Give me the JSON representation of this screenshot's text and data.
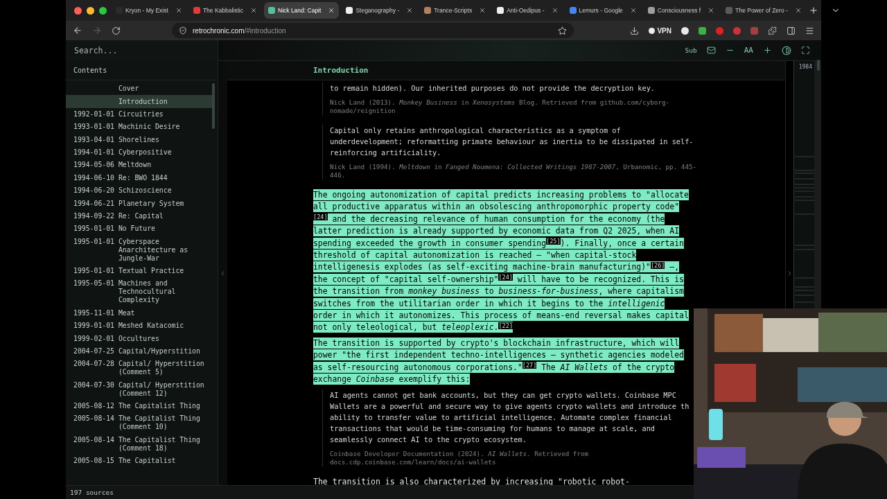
{
  "browser": {
    "tabs": [
      {
        "title": "Kryon - My Exist",
        "selected": false,
        "color": "#2b2b2b"
      },
      {
        "title": "The Kabbalistic",
        "selected": false,
        "color": "#e53935"
      },
      {
        "title": "Nick Land: Capit",
        "selected": true,
        "color": "#4fc3a1"
      },
      {
        "title": "Steganography -",
        "selected": false,
        "color": "#eeeeee"
      },
      {
        "title": "Trance-Scripts",
        "selected": false,
        "color": "#b08060"
      },
      {
        "title": "Anti-Oedipus -",
        "selected": false,
        "color": "#eeeeee"
      },
      {
        "title": "Lemurs - Google",
        "selected": false,
        "color": "#4285f4"
      },
      {
        "title": "Consciousness f",
        "selected": false,
        "color": "#9e9e9e"
      },
      {
        "title": "The Power of Zero -",
        "selected": false,
        "color": "#5a5a5a"
      }
    ],
    "address": {
      "host": "retrochronic.com",
      "path": "/#introduction"
    },
    "vpn_label": "VPN"
  },
  "app": {
    "search": {
      "placeholder": "Search..."
    },
    "toolbar": {
      "sub_label": "Sub",
      "font_label": "AA"
    },
    "sidebar": {
      "title": "Contents",
      "footer": "197 sources",
      "items": [
        {
          "title": "Cover",
          "selected": false
        },
        {
          "title": "Introduction",
          "selected": true
        },
        {
          "date": "1992-01-01",
          "title": "Circuitries",
          "selected": false
        },
        {
          "date": "1993-01-01",
          "title": "Machinic Desire",
          "selected": false
        },
        {
          "date": "1993-04-01",
          "title": "Shorelines",
          "selected": false
        },
        {
          "date": "1994-01-01",
          "title": "Cyberpositive",
          "selected": false
        },
        {
          "date": "1994-05-06",
          "title": "Meltdown",
          "selected": false
        },
        {
          "date": "1994-06-10",
          "title": "Re: BWO 1844",
          "selected": false
        },
        {
          "date": "1994-06-20",
          "title": "Schizoscience",
          "selected": false
        },
        {
          "date": "1994-06-21",
          "title": "Planetary System",
          "selected": false
        },
        {
          "date": "1994-09-22",
          "title": "Re: Capital",
          "selected": false
        },
        {
          "date": "1995-01-01",
          "title": "No Future",
          "selected": false
        },
        {
          "date": "1995-01-01",
          "title": "Cyberspace Anarchitecture as Jungle-War",
          "selected": false
        },
        {
          "date": "1995-01-01",
          "title": "Textual Practice",
          "selected": false
        },
        {
          "date": "1995-05-01",
          "title": "Machines and Technocultural Complexity",
          "selected": false
        },
        {
          "date": "1995-11-01",
          "title": "Meat",
          "selected": false
        },
        {
          "date": "1999-01-01",
          "title": "Meshed Katacomic",
          "selected": false
        },
        {
          "date": "1999-02-01",
          "title": "Occultures",
          "selected": false
        },
        {
          "date": "2004-07-25",
          "title": "Capital/Hyperstition",
          "selected": false
        },
        {
          "date": "2004-07-28",
          "title": "Capital/ Hyperstition (Comment 5)",
          "selected": false
        },
        {
          "date": "2004-07-30",
          "title": "Capital/ Hyperstition (Comment 12)",
          "selected": false
        },
        {
          "date": "2005-08-12",
          "title": "The Capitalist Thing",
          "selected": false
        },
        {
          "date": "2005-08-14",
          "title": "The Capitalist Thing (Comment 10)",
          "selected": false
        },
        {
          "date": "2005-08-14",
          "title": "The Capitalist Thing (Comment 18)",
          "selected": false
        },
        {
          "date": "2005-08-15",
          "title": "The Capitalist",
          "selected": false
        }
      ]
    },
    "main": {
      "heading": "Introduction",
      "blocks": [
        {
          "kind": "quote",
          "text": "to remain hidden). Our inherited purposes do not provide the decryption key.",
          "citation": "Nick Land (2013). *Monkey Business* in *Xenosystems* Blog. Retrieved from github.com/cyborg-nomade/reignition"
        },
        {
          "kind": "quote",
          "text": "Capital only retains anthropological characteristics as a symptom of underdevelopment; reformatting primate behaviour as inertia to be dissipated in self-reinforcing artificiality.",
          "citation": "Nick Land (1994). *Meltdown* in *Fanged Noumena: Collected Writings 1987-2007*, Urbanomic, pp. 445-446."
        },
        {
          "kind": "highlight",
          "text": "The ongoing autonomization of capital predicts increasing problems to \"allocate all productive apparatus within an obsolescing anthropomorphic property code\"$^{[24]}$ and the decreasing relevance of human consumption for the economy (the latter prediction is already supported by economic data from Q2 2025, when AI spending exceeded the growth in consumer spending$^{[25]}$). Finally, once a certain threshold of capital autonomization is reached — \"when capital-stock intelligenesis explodes (as self-exciting machine-brain manufacturing)\"$^{[26]}$ —, the concept of \"capital self-ownership\"$^{[24]}$ will have to be recognized. This is the transition from *monkey business* to *business-for-business*, where capitalism switches from the utilitarian order in which it begins to the *intelligenic* order in which it autonomizes. This process of means-end reversal makes capital not only teleological, but *teleoplexic*.$^{[22]}$"
        },
        {
          "kind": "highlight",
          "text": "The transition is supported by crypto's blockchain infrastructure, which will power \"the first independent techno-intelligences — synthetic agencies modeled as self-resourcing autonomous corporations.\"$^{[27]}$ The *AI Wallets* of the crypto exchange *Coinbase* exemplify this:"
        },
        {
          "kind": "quote",
          "text": "AI agents cannot get bank accounts, but they can get crypto wallets. Coinbase MPC Wallets are a powerful and secure way to give agents crypto wallets and introduce th ability to transfer value to artificial intelligence. Automate complex financial transactions that would be time-consuming for humans to manage at scale, and seamlessly connect AI to the crypto ecosystem.",
          "citation": "Coinbase Developer Documentation (2024). *AI Wallets*. Retrieved from docs.cdp.coinbase.com/learn/docs/ai-wallets"
        },
        {
          "kind": "paragraph",
          "text": "The transition is also characterized by increasing \"robotic robot-"
        }
      ]
    },
    "minimap": {
      "label": "1984"
    }
  }
}
